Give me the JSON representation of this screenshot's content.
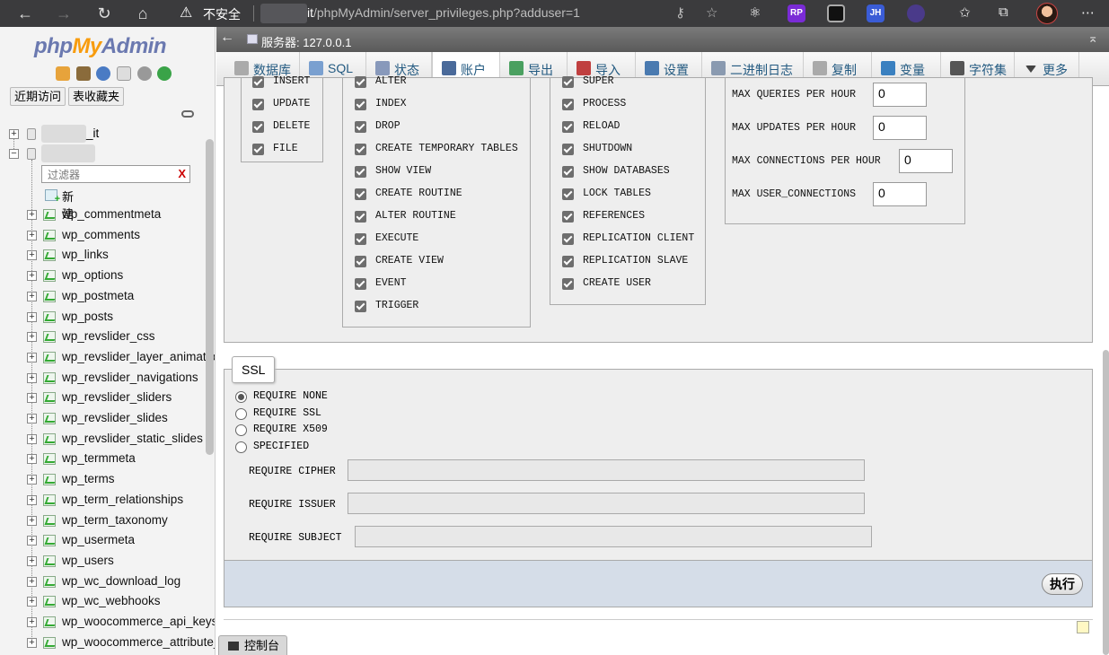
{
  "browser": {
    "security_warning": "不安全",
    "url_host_suffix": "it",
    "url_path": "/phpMyAdmin/server_privileges.php?adduser=1",
    "ext_jh": "JH",
    "ext_rp": "RP"
  },
  "sidebar": {
    "logo_php": "php",
    "logo_my": "My",
    "logo_admin": "Admin",
    "recent_tab": "近期访问",
    "favorites_tab": "表收藏夹",
    "db1_suffix": "_it",
    "filter_placeholder": "过滤器",
    "filter_clear": "X",
    "new_label": "新建",
    "tables": [
      "wp_commentmeta",
      "wp_comments",
      "wp_links",
      "wp_options",
      "wp_postmeta",
      "wp_posts",
      "wp_revslider_css",
      "wp_revslider_layer_animations",
      "wp_revslider_navigations",
      "wp_revslider_sliders",
      "wp_revslider_slides",
      "wp_revslider_static_slides",
      "wp_termmeta",
      "wp_terms",
      "wp_term_relationships",
      "wp_term_taxonomy",
      "wp_usermeta",
      "wp_users",
      "wp_wc_download_log",
      "wp_wc_webhooks",
      "wp_woocommerce_api_keys",
      "wp_woocommerce_attribute_taxonomies"
    ]
  },
  "server_bar": {
    "label": "服务器: 127.0.0.1"
  },
  "menu": {
    "tabs": [
      "数据库",
      "SQL",
      "状态",
      "账户",
      "导出",
      "导入",
      "设置",
      "二进制日志",
      "复制",
      "变量",
      "字符集",
      "更多"
    ],
    "active": "账户"
  },
  "privileges": {
    "data": [
      "INSERT",
      "UPDATE",
      "DELETE",
      "FILE"
    ],
    "structure": [
      "ALTER",
      "INDEX",
      "DROP",
      "CREATE TEMPORARY TABLES",
      "SHOW VIEW",
      "CREATE ROUTINE",
      "ALTER ROUTINE",
      "EXECUTE",
      "CREATE VIEW",
      "EVENT",
      "TRIGGER"
    ],
    "administration": [
      "SUPER",
      "PROCESS",
      "RELOAD",
      "SHUTDOWN",
      "SHOW DATABASES",
      "LOCK TABLES",
      "REFERENCES",
      "REPLICATION CLIENT",
      "REPLICATION SLAVE",
      "CREATE USER"
    ],
    "all_checked": true
  },
  "limits": [
    {
      "label": "MAX QUERIES PER HOUR",
      "value": "0"
    },
    {
      "label": "MAX UPDATES PER HOUR",
      "value": "0"
    },
    {
      "label": "MAX CONNECTIONS PER HOUR",
      "value": "0"
    },
    {
      "label": "MAX USER_CONNECTIONS",
      "value": "0"
    }
  ],
  "ssl": {
    "legend": "SSL",
    "options": [
      "REQUIRE NONE",
      "REQUIRE SSL",
      "REQUIRE X509",
      "SPECIFIED"
    ],
    "selected": "REQUIRE NONE",
    "cipher_label": "REQUIRE CIPHER",
    "issuer_label": "REQUIRE ISSUER",
    "subject_label": "REQUIRE SUBJECT",
    "cipher_value": "",
    "issuer_value": "",
    "subject_value": ""
  },
  "footer": {
    "go_button": "执行",
    "console_tab": "控制台"
  }
}
